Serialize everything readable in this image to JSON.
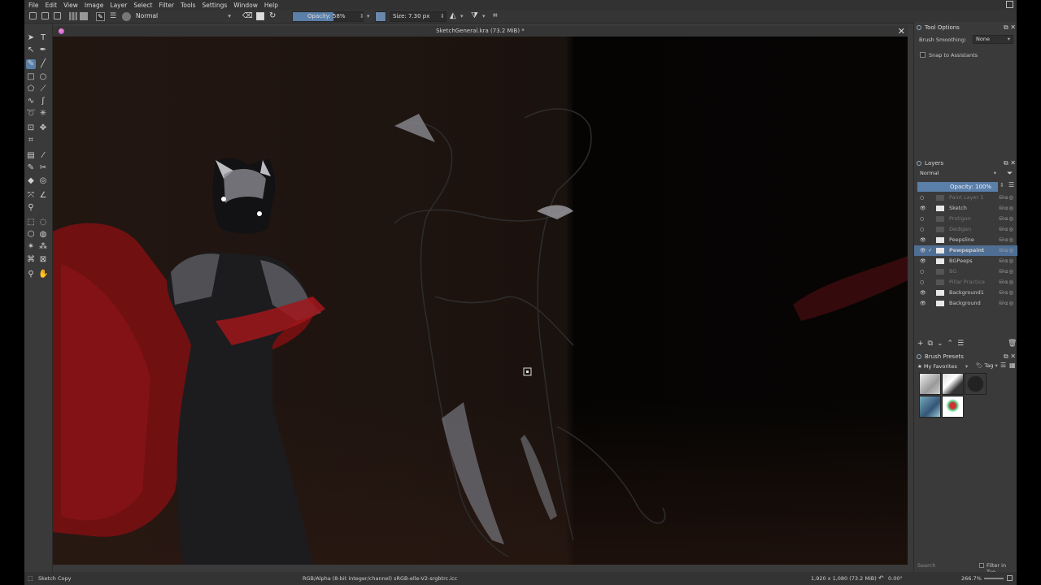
{
  "menu": [
    "File",
    "Edit",
    "View",
    "Image",
    "Layer",
    "Select",
    "Filter",
    "Tools",
    "Settings",
    "Window",
    "Help"
  ],
  "toolbar": {
    "blend_mode": "Normal",
    "opacity_label": "Opacity: 58%",
    "opacity_value": 58,
    "size_label": "Size: 7.30 px"
  },
  "document": {
    "title": "SketchGeneral.kra (73.2 MiB) *"
  },
  "tool_options": {
    "title": "Tool Options",
    "smoothing_label": "Brush Smoothing:",
    "smoothing_value": "None",
    "snap_label": "Snap to Assistants"
  },
  "layers": {
    "title": "Layers",
    "blend_mode": "Normal",
    "opacity_label": "Opacity: 100%",
    "items": [
      {
        "name": "Paint Layer 1",
        "visible": false
      },
      {
        "name": "Sketch",
        "visible": true
      },
      {
        "name": "Protigan",
        "visible": false
      },
      {
        "name": "Dedigan",
        "visible": false
      },
      {
        "name": "Peepsline",
        "visible": true
      },
      {
        "name": "Pewpepaint",
        "visible": true,
        "selected": true
      },
      {
        "name": "BGPeeps",
        "visible": true
      },
      {
        "name": "BG",
        "visible": false
      },
      {
        "name": "Pillar Practice",
        "visible": false
      },
      {
        "name": "Background1",
        "visible": true
      },
      {
        "name": "Background",
        "visible": true
      }
    ]
  },
  "brush_presets": {
    "title": "Brush Presets",
    "tag_filter": "My Favorites",
    "tag_label": "Tag",
    "search_placeholder": "Search",
    "filter_label": "Filter in Tag"
  },
  "status": {
    "current_layer": "Sketch Copy",
    "color_profile": "RGB/Alpha (8-bit integer/channel)  sRGB-elle-V2-srgbtrc.icc",
    "image_size": "1,920 x 1,080 (73.2 MiB)",
    "rotation": "0.00°",
    "zoom": "266.7%"
  },
  "colors": {
    "accent": "#5a7fa8",
    "panel": "#3a3a3a",
    "selection": "#4f6e94"
  }
}
